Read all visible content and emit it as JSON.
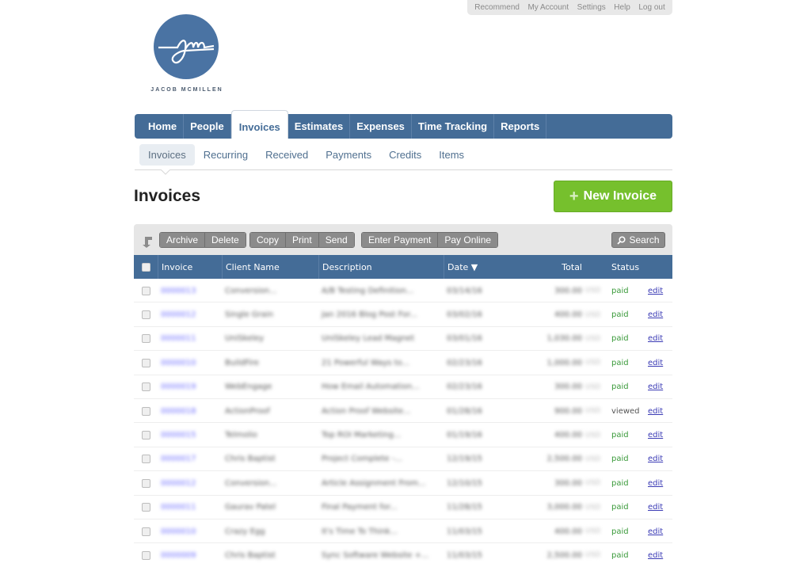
{
  "util_links": [
    "Recommend",
    "My Account",
    "Settings",
    "Help",
    "Log out"
  ],
  "logo": {
    "monogram": "jm",
    "name": "JACOB MCMILLEN",
    "color": "#4a73a3"
  },
  "main_nav": {
    "tabs": [
      {
        "label": "Home",
        "active": false
      },
      {
        "label": "People",
        "active": false
      },
      {
        "label": "Invoices",
        "active": true
      },
      {
        "label": "Estimates",
        "active": false
      },
      {
        "label": "Time Tracking",
        "active": false
      },
      {
        "label": "Expenses",
        "active": false
      },
      {
        "label": "Reports",
        "active": false
      }
    ]
  },
  "sub_nav": {
    "items": [
      {
        "label": "Invoices",
        "active": true
      },
      {
        "label": "Recurring",
        "active": false
      },
      {
        "label": "Received",
        "active": false
      },
      {
        "label": "Payments",
        "active": false
      },
      {
        "label": "Credits",
        "active": false
      },
      {
        "label": "Items",
        "active": false
      }
    ]
  },
  "page": {
    "title": "Invoices",
    "new_button": "New Invoice"
  },
  "toolbar": {
    "group1": [
      "Archive",
      "Delete"
    ],
    "group2": [
      "Copy",
      "Print",
      "Send"
    ],
    "group3": [
      "Enter Payment",
      "Pay Online"
    ],
    "search": "Search"
  },
  "table": {
    "headers": {
      "invoice": "Invoice",
      "client": "Client Name",
      "description": "Description",
      "date": "Date ▼",
      "total": "Total",
      "status": "Status"
    },
    "rows": [
      {
        "invoice": "0000013",
        "client": "Conversion...",
        "description": "A/B Testing Definition...",
        "date": "03/14/16",
        "total": "300.00",
        "currency": "USD",
        "status": "paid",
        "action": "edit"
      },
      {
        "invoice": "0000012",
        "client": "Single Grain",
        "description": "Jan 2016 Blog Post For...",
        "date": "03/02/16",
        "total": "400.00",
        "currency": "USD",
        "status": "paid",
        "action": "edit"
      },
      {
        "invoice": "0000011",
        "client": "UniSkeley",
        "description": "UniSkeley Lead Magnet",
        "date": "03/01/16",
        "total": "1,030.00",
        "currency": "USD",
        "status": "paid",
        "action": "edit"
      },
      {
        "invoice": "0000010",
        "client": "BuildFire",
        "description": "21 Powerful Ways to...",
        "date": "02/23/16",
        "total": "1,000.00",
        "currency": "USD",
        "status": "paid",
        "action": "edit"
      },
      {
        "invoice": "0000019",
        "client": "WebEngage",
        "description": "How Email Automation...",
        "date": "02/23/16",
        "total": "300.00",
        "currency": "USD",
        "status": "paid",
        "action": "edit"
      },
      {
        "invoice": "0000018",
        "client": "ActionProof",
        "description": "Action Proof Website...",
        "date": "01/28/16",
        "total": "900.00",
        "currency": "USD",
        "status": "viewed",
        "action": "edit"
      },
      {
        "invoice": "0000015",
        "client": "Telmolio",
        "description": "Top ROI Marketing...",
        "date": "01/19/16",
        "total": "400.00",
        "currency": "USD",
        "status": "paid",
        "action": "edit"
      },
      {
        "invoice": "0000017",
        "client": "Chris Baptist",
        "description": "Project Complete -...",
        "date": "12/19/15",
        "total": "2,500.00",
        "currency": "USD",
        "status": "paid",
        "action": "edit"
      },
      {
        "invoice": "0000012",
        "client": "Conversion...",
        "description": "Article Assignment From...",
        "date": "12/10/15",
        "total": "300.00",
        "currency": "USD",
        "status": "paid",
        "action": "edit"
      },
      {
        "invoice": "0000011",
        "client": "Gaurav Patel",
        "description": "Final Payment for...",
        "date": "11/28/15",
        "total": "3,000.00",
        "currency": "USD",
        "status": "paid",
        "action": "edit"
      },
      {
        "invoice": "0000010",
        "client": "Crazy Egg",
        "description": "It's Time To Think...",
        "date": "11/03/15",
        "total": "400.00",
        "currency": "USD",
        "status": "paid",
        "action": "edit"
      },
      {
        "invoice": "0000009",
        "client": "Chris Baptist",
        "description": "Sync Software Website +...",
        "date": "11/03/15",
        "total": "2,500.00",
        "currency": "USD",
        "status": "paid",
        "action": "edit"
      }
    ]
  },
  "colors": {
    "nav_blue": "#446c97",
    "new_green": "#76c02d",
    "paid_green": "#3a9a3a",
    "link_blue": "#3b3bb5"
  }
}
